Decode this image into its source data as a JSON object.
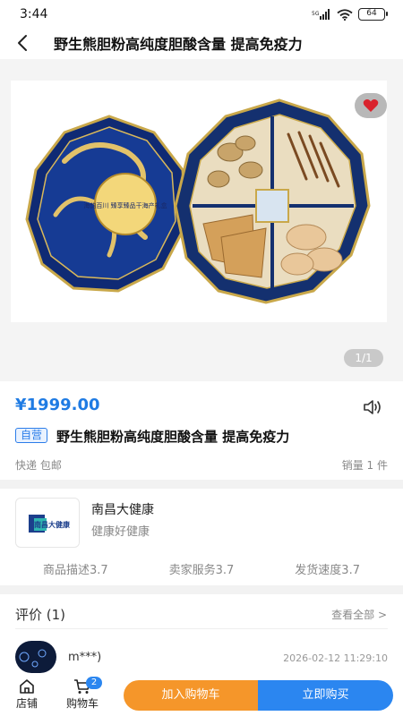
{
  "status_bar": {
    "time": "3:44",
    "signal": "5G",
    "battery": "64"
  },
  "nav": {
    "title": "野生熊胆粉高纯度胆酸含量 提高免疫力"
  },
  "gallery": {
    "page_indicator": "1/1",
    "box_label": "海韵百川 臻享臻品干海产礼盒"
  },
  "product": {
    "price": "¥1999.00",
    "tag": "自营",
    "title": "野生熊胆粉高纯度胆酸含量 提高免疫力",
    "shipping": "快递 包邮",
    "sales": "销量 1 件"
  },
  "store": {
    "name": "南昌大健康",
    "slogan": "健康好健康",
    "logo_text": "南昌大健康",
    "ratings": [
      "商品描述3.7",
      "卖家服务3.7",
      "发货速度3.7"
    ]
  },
  "reviews": {
    "title": "评价 (1)",
    "view_all": "查看全部 >",
    "items": [
      {
        "user": "m***)",
        "date": "2026-02-12 11:29:10"
      }
    ]
  },
  "bottom": {
    "store_label": "店铺",
    "cart_label": "购物车",
    "cart_count": "2",
    "add_to_cart": "加入购物车",
    "buy_now": "立即购买"
  },
  "colors": {
    "accent": "#2b86f0",
    "price": "#1f7be3",
    "cart_button": "#f5962a",
    "favorite": "#d9232d"
  }
}
